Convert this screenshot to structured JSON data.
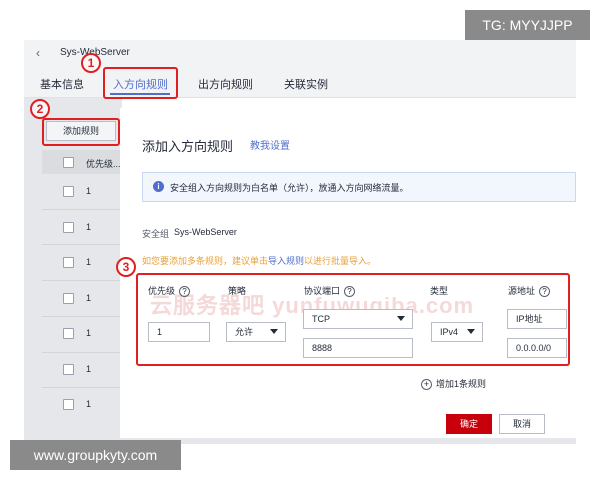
{
  "overlay": {
    "tg_text": "TG: MYYJJPP",
    "site_text": "www.groupkyty.com"
  },
  "header": {
    "back_icon": "chevron-left-icon",
    "server_name": "Sys-WebServer",
    "tabs": [
      {
        "label": "基本信息"
      },
      {
        "label": "入方向规则"
      },
      {
        "label": "出方向规则"
      },
      {
        "label": "关联实例"
      }
    ],
    "active_tab": 1
  },
  "table": {
    "add_rule_label": "添加规则",
    "priority_header": "优先级...",
    "rows": [
      "1",
      "1",
      "1",
      "1",
      "1",
      "1",
      "1"
    ]
  },
  "dialog": {
    "title": "添加入方向规则",
    "help_link": "教我设置",
    "notice": "安全组入方向规则为白名单（允许），放通入方向网络流量。",
    "sg_label": "安全组",
    "sg_value": "Sys-WebServer",
    "tip_prefix": "如您要添加多条规则，建议单击",
    "tip_link": "导入规则",
    "tip_suffix": "以进行批量导入。",
    "labels": {
      "priority": "优先级",
      "policy": "策略",
      "protocol_port": "协议端口",
      "type": "类型",
      "source": "源地址"
    },
    "values": {
      "priority": "1",
      "policy": "允许",
      "protocol": "TCP",
      "port": "8888",
      "type": "IPv4",
      "source_type": "IP地址",
      "source_ip": "0.0.0.0/0"
    },
    "watermark": "云服务器吧 yunfuwuqiba.com",
    "add_one_rule": "增加1条规则",
    "confirm_label": "确定",
    "cancel_label": "取消"
  },
  "annotations": [
    "1",
    "2",
    "3"
  ],
  "colors": {
    "accent": "#526ecc",
    "primary_button": "#c7000b",
    "annotation_red": "#e02020",
    "warning_text": "#e6a23c"
  }
}
